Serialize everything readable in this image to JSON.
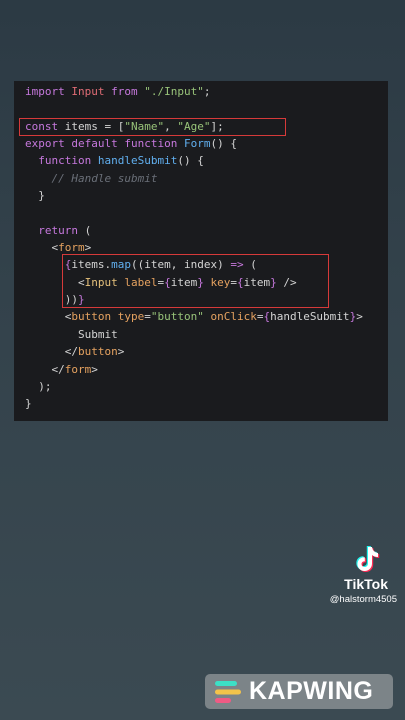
{
  "code": {
    "lines": [
      [
        [
          "kw",
          "import"
        ],
        [
          "pl",
          " "
        ],
        [
          "var",
          "Input"
        ],
        [
          "pl",
          " "
        ],
        [
          "kw",
          "from"
        ],
        [
          "pl",
          " "
        ],
        [
          "str",
          "\"./Input\""
        ],
        [
          "pl",
          ";"
        ]
      ],
      [],
      [
        [
          "kw",
          "const"
        ],
        [
          "pl",
          " items = ["
        ],
        [
          "str",
          "\"Name\""
        ],
        [
          "pl",
          ", "
        ],
        [
          "str",
          "\"Age\""
        ],
        [
          "pl",
          "];"
        ]
      ],
      [
        [
          "kw",
          "export"
        ],
        [
          "pl",
          " "
        ],
        [
          "kw",
          "default"
        ],
        [
          "pl",
          " "
        ],
        [
          "kw",
          "function"
        ],
        [
          "pl",
          " "
        ],
        [
          "fn",
          "Form"
        ],
        [
          "pl",
          "() {"
        ]
      ],
      [
        [
          "pl",
          "  "
        ],
        [
          "kw",
          "function"
        ],
        [
          "pl",
          " "
        ],
        [
          "fn",
          "handleSubmit"
        ],
        [
          "pl",
          "() {"
        ]
      ],
      [
        [
          "pl",
          "    "
        ],
        [
          "cm",
          "// Handle submit"
        ]
      ],
      [
        [
          "pl",
          "  }"
        ]
      ],
      [],
      [
        [
          "pl",
          "  "
        ],
        [
          "kw",
          "return"
        ],
        [
          "pl",
          " ("
        ]
      ],
      [
        [
          "pl",
          "    <"
        ],
        [
          "tag",
          "form"
        ],
        [
          "pl",
          ">"
        ]
      ],
      [
        [
          "pl",
          "      "
        ],
        [
          "kw",
          "{"
        ],
        [
          "pl",
          "items."
        ],
        [
          "fn",
          "map"
        ],
        [
          "pl",
          "((item, index) "
        ],
        [
          "kw",
          "=>"
        ],
        [
          "pl",
          " ("
        ]
      ],
      [
        [
          "pl",
          "        <"
        ],
        [
          "attr",
          "Input"
        ],
        [
          "pl",
          " "
        ],
        [
          "tag",
          "label"
        ],
        [
          "pl",
          "="
        ],
        [
          "kw",
          "{"
        ],
        [
          "pl",
          "item"
        ],
        [
          "kw",
          "}"
        ],
        [
          "pl",
          " "
        ],
        [
          "tag",
          "key"
        ],
        [
          "pl",
          "="
        ],
        [
          "kw",
          "{"
        ],
        [
          "pl",
          "item"
        ],
        [
          "kw",
          "}"
        ],
        [
          "pl",
          " />"
        ]
      ],
      [
        [
          "pl",
          "      ))"
        ],
        [
          "kw",
          "}"
        ]
      ],
      [
        [
          "pl",
          "      <"
        ],
        [
          "tag",
          "button"
        ],
        [
          "pl",
          " "
        ],
        [
          "tag",
          "type"
        ],
        [
          "pl",
          "="
        ],
        [
          "str",
          "\"button\""
        ],
        [
          "pl",
          " "
        ],
        [
          "tag",
          "onClick"
        ],
        [
          "pl",
          "="
        ],
        [
          "kw",
          "{"
        ],
        [
          "pl",
          "handleSubmit"
        ],
        [
          "kw",
          "}"
        ],
        [
          "pl",
          ">"
        ]
      ],
      [
        [
          "pl",
          "        Submit"
        ]
      ],
      [
        [
          "pl",
          "      </"
        ],
        [
          "tag",
          "button"
        ],
        [
          "pl",
          ">"
        ]
      ],
      [
        [
          "pl",
          "    </"
        ],
        [
          "tag",
          "form"
        ],
        [
          "pl",
          ">"
        ]
      ],
      [
        [
          "pl",
          "  );"
        ]
      ],
      [
        [
          "pl",
          "}"
        ]
      ]
    ]
  },
  "tiktok": {
    "name": "TikTok",
    "handle": "@halstorm4505",
    "logo_icon": "tiktok-note-icon"
  },
  "watermark": {
    "text": "KAPWING",
    "icon": "kapwing-logo-icon"
  },
  "colors": {
    "highlight": "#d63a3a",
    "panel": "#1a1b1e",
    "background": "#33424b"
  }
}
